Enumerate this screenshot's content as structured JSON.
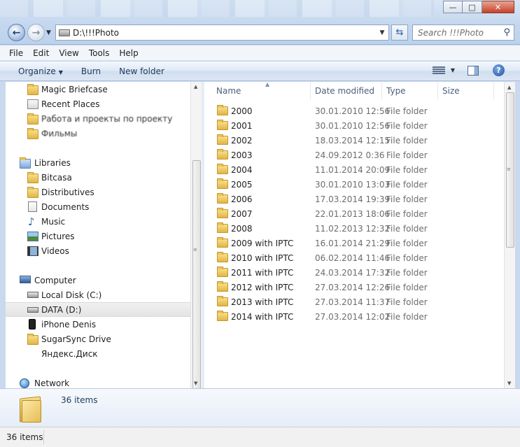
{
  "window": {
    "minimize_glyph": "—",
    "maximize_glyph": "□",
    "close_glyph": "✕"
  },
  "address_bar": {
    "path": "D:\\!!!Photo",
    "search_placeholder": "Search !!!Photo"
  },
  "menu": {
    "items": [
      "File",
      "Edit",
      "View",
      "Tools",
      "Help"
    ]
  },
  "command_bar": {
    "organize": "Organize",
    "burn": "Burn",
    "new_folder": "New folder"
  },
  "nav_pane": {
    "favorites": [
      {
        "label": "Magic Briefcase",
        "icon": "folder-icon"
      },
      {
        "label": "Recent Places",
        "icon": "recent-places-icon"
      },
      {
        "label": "Работа и проекты по проекту",
        "icon": "folder-icon"
      },
      {
        "label": "Фильмы",
        "icon": "folder-icon"
      }
    ],
    "libraries_label": "Libraries",
    "libraries": [
      {
        "label": "Bitcasa",
        "icon": "folder-icon"
      },
      {
        "label": "Distributives",
        "icon": "folder-icon"
      },
      {
        "label": "Documents",
        "icon": "documents-icon"
      },
      {
        "label": "Music",
        "icon": "music-icon"
      },
      {
        "label": "Pictures",
        "icon": "pictures-icon"
      },
      {
        "label": "Videos",
        "icon": "videos-icon"
      }
    ],
    "computer_label": "Computer",
    "computer": [
      {
        "label": "Local Disk (C:)",
        "icon": "windows-drive-icon"
      },
      {
        "label": "DATA (D:)",
        "icon": "drive-icon",
        "selected": true
      },
      {
        "label": "iPhone Denis",
        "icon": "phone-icon"
      },
      {
        "label": "SugarSync Drive",
        "icon": "folder-icon"
      },
      {
        "label": "Яндекс.Диск",
        "icon": "none"
      }
    ],
    "network_label": "Network"
  },
  "columns": {
    "name": "Name",
    "date": "Date modified",
    "type": "Type",
    "size": "Size"
  },
  "files": [
    {
      "name": "2000",
      "date": "30.01.2010 12:56",
      "type": "File folder"
    },
    {
      "name": "2001",
      "date": "30.01.2010 12:56",
      "type": "File folder"
    },
    {
      "name": "2002",
      "date": "18.03.2014 12:15",
      "type": "File folder"
    },
    {
      "name": "2003",
      "date": "24.09.2012 0:36",
      "type": "File folder"
    },
    {
      "name": "2004",
      "date": "11.01.2014 20:09",
      "type": "File folder"
    },
    {
      "name": "2005",
      "date": "30.01.2010 13:03",
      "type": "File folder"
    },
    {
      "name": "2006",
      "date": "17.03.2014 19:39",
      "type": "File folder"
    },
    {
      "name": "2007",
      "date": "22.01.2013 18:06",
      "type": "File folder"
    },
    {
      "name": "2008",
      "date": "11.02.2013 12:32",
      "type": "File folder"
    },
    {
      "name": "2009 with IPTC",
      "date": "16.01.2014 21:29",
      "type": "File folder"
    },
    {
      "name": "2010 with IPTC",
      "date": "06.02.2014 11:46",
      "type": "File folder"
    },
    {
      "name": "2011 with IPTC",
      "date": "24.03.2014 17:32",
      "type": "File folder"
    },
    {
      "name": "2012 with IPTC",
      "date": "27.03.2014 12:26",
      "type": "File folder"
    },
    {
      "name": "2013 with IPTC",
      "date": "27.03.2014 11:37",
      "type": "File folder"
    },
    {
      "name": "2014 with IPTC",
      "date": "27.03.2014 12:02",
      "type": "File folder"
    }
  ],
  "details_pane": {
    "count": "36 items"
  },
  "status_bar": {
    "count": "36 items"
  }
}
